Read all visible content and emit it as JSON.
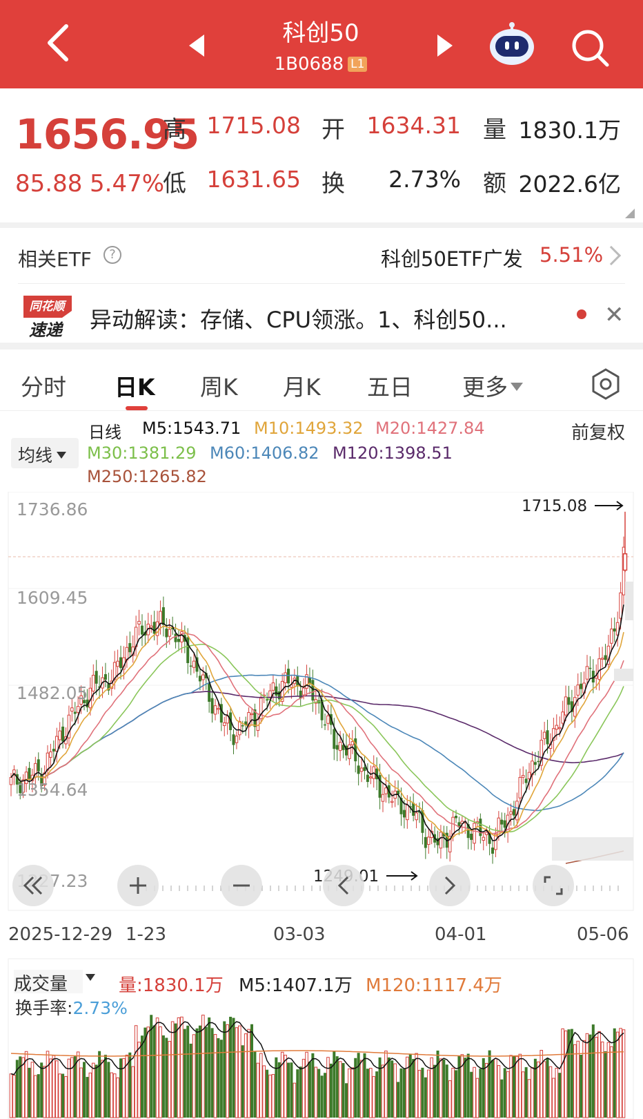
{
  "header": {
    "title": "科创50",
    "code": "1B0688",
    "badge": "L1"
  },
  "quote": {
    "price": "1656.95",
    "change": "85.88",
    "change_pct": "5.47%",
    "high_label": "高",
    "high": "1715.08",
    "open_label": "开",
    "open": "1634.31",
    "volume_label": "量",
    "volume": "1830.1万",
    "low_label": "低",
    "low": "1631.65",
    "turnover_label": "换",
    "turnover": "2.73%",
    "amount_label": "额",
    "amount": "2022.6亿"
  },
  "etf": {
    "label": "相关ETF",
    "name": "科创50ETF广发",
    "pct": "5.51%"
  },
  "news": {
    "logo_top": "同花顺",
    "logo_bottom": "速递",
    "text": "异动解读：存储、CPU领涨。1、科创50..."
  },
  "tabs": [
    "分时",
    "日K",
    "周K",
    "月K",
    "五日",
    "更多"
  ],
  "ma_legend": {
    "button": "均线",
    "type": "日线",
    "m5": "M5:1543.71",
    "m10": "M10:1493.32",
    "m20": "M20:1427.84",
    "m30": "M30:1381.29",
    "m60": "M60:1406.82",
    "m120": "M120:1398.51",
    "m250": "M250:1265.82",
    "adjust": "前复权"
  },
  "colors": {
    "up": "#d5403a",
    "down": "#3d7a2a",
    "m5": "#111111",
    "m10": "#e0a53a",
    "m20": "#e0717a",
    "m30": "#8ac65a",
    "m60": "#4c87b8",
    "m120": "#5a2a6a",
    "m250": "#a8523a"
  },
  "chart_data": {
    "type": "candlestick",
    "y_ticks": [
      "1736.86",
      "1609.45",
      "1482.05",
      "1354.64",
      "1227.23"
    ],
    "x_labels": [
      "2025-12-29",
      "1-23",
      "03-03",
      "04-01",
      "05-06"
    ],
    "annotations": {
      "max": "1715.08",
      "min": "1249.01"
    },
    "ylim": [
      1227.23,
      1736.86
    ],
    "last_candle": {
      "open": 1634.31,
      "high": 1715.08,
      "low": 1631.65,
      "close": 1656.95
    }
  },
  "volume": {
    "label": "成交量",
    "vol": "量:1830.1万",
    "m5": "M5:1407.1万",
    "m120": "M120:1117.4万",
    "turnover_label": "换手率:",
    "turnover": "2.73%"
  }
}
